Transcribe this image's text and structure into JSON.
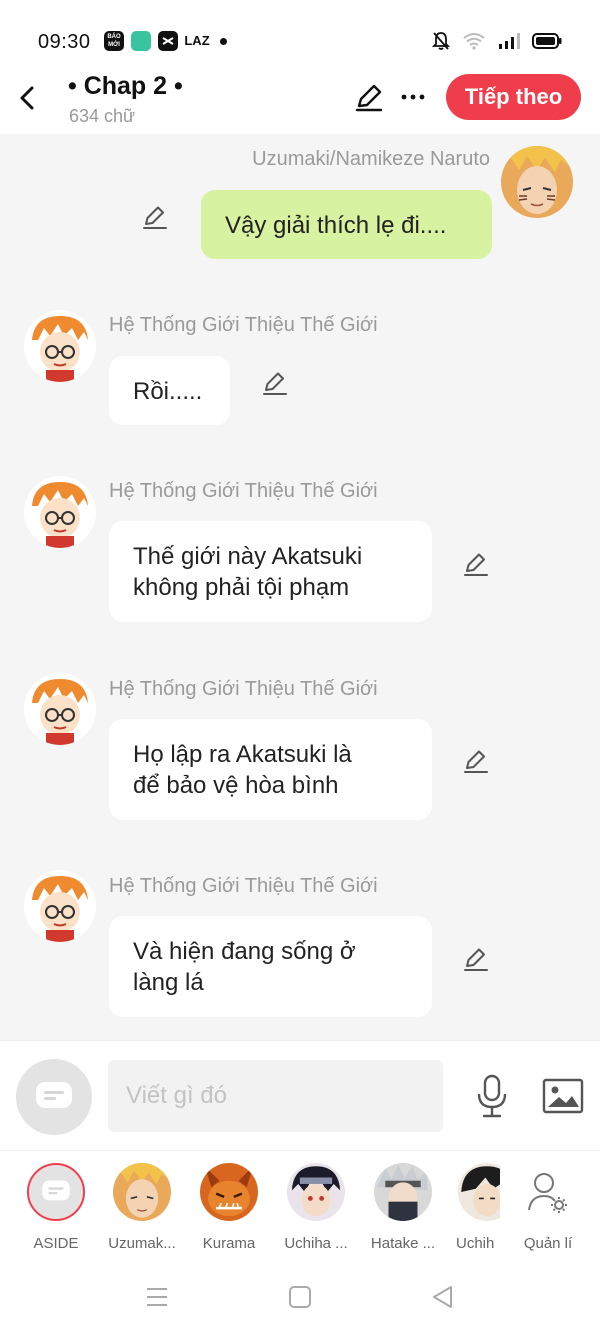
{
  "status_bar": {
    "time": "09:30",
    "app_icons": [
      "BÁO MỚI",
      "",
      "",
      "LAZ"
    ]
  },
  "header": {
    "title": "• Chap 2 •",
    "word_count": "634 chữ",
    "next_label": "Tiếp theo"
  },
  "messages": [
    {
      "sender": "Uzumaki/Namikeze Naruto",
      "text": "Vậy giải thích lẹ đi....",
      "side": "right"
    },
    {
      "sender": "Hệ Thống Giới Thiệu Thế Giới",
      "text": "Rồi.....",
      "side": "left"
    },
    {
      "sender": "Hệ Thống Giới Thiệu Thế Giới",
      "text": "Thế giới này Akatsuki\nkhông phải tội phạm",
      "side": "left"
    },
    {
      "sender": "Hệ Thống Giới Thiệu Thế Giới",
      "text": "Họ lập ra Akatsuki là\nđể bảo vệ hòa bình",
      "side": "left"
    },
    {
      "sender": "Hệ Thống Giới Thiệu Thế Giới",
      "text": "Và hiện đang sống ở\nlàng lá",
      "side": "left"
    }
  ],
  "composer": {
    "placeholder": "Viết gì đó"
  },
  "characters": [
    {
      "label": "ASIDE"
    },
    {
      "label": "Uzumak..."
    },
    {
      "label": "Kurama"
    },
    {
      "label": "Uchiha ..."
    },
    {
      "label": "Hatake ..."
    },
    {
      "label": "Uchih"
    },
    {
      "label": "Quản lí"
    }
  ],
  "colors": {
    "accent": "#ef3d4c",
    "own_bubble": "#d7f2a0",
    "other_bubble": "#ffffff",
    "background": "#f5f5f5"
  }
}
